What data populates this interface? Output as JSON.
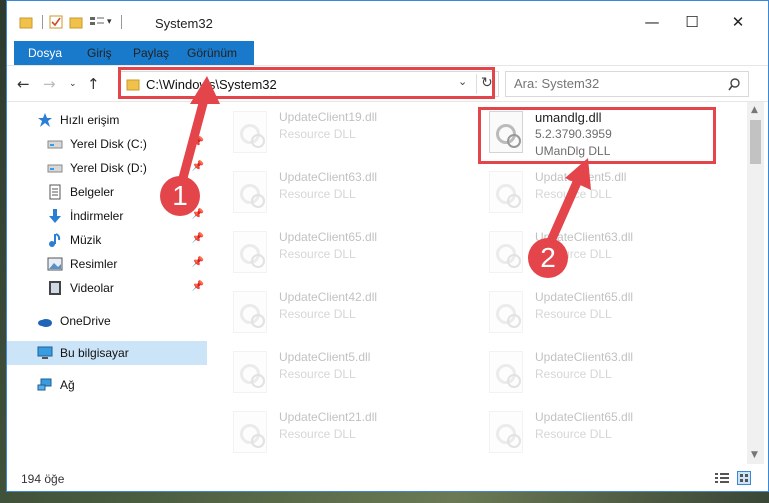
{
  "window": {
    "title": "System32",
    "minimize_icon": "minimize-icon",
    "maximize_icon": "maximize-icon",
    "close_icon": "close-icon"
  },
  "ribbon": {
    "tabs": [
      {
        "label": "Dosya"
      },
      {
        "label": "Giriş"
      },
      {
        "label": "Paylaş"
      },
      {
        "label": "Görünüm"
      }
    ]
  },
  "address": {
    "path": "C:\\Windows\\System32"
  },
  "search": {
    "placeholder": "Ara: System32"
  },
  "sidebar": {
    "items": [
      {
        "label": "Hızlı erişim",
        "icon": "star-icon"
      },
      {
        "label": "Yerel Disk (C:)",
        "icon": "drive-icon"
      },
      {
        "label": "Yerel Disk (D:)",
        "icon": "drive-icon"
      },
      {
        "label": "Belgeler",
        "icon": "documents-icon"
      },
      {
        "label": "İndirmeler",
        "icon": "download-icon"
      },
      {
        "label": "Müzik",
        "icon": "music-icon"
      },
      {
        "label": "Resimler",
        "icon": "pictures-icon"
      },
      {
        "label": "Videolar",
        "icon": "videos-icon"
      },
      {
        "label": "OneDrive",
        "icon": "cloud-icon"
      },
      {
        "label": "Bu bilgisayar",
        "icon": "computer-icon"
      },
      {
        "label": "Ağ",
        "icon": "network-icon"
      }
    ]
  },
  "files": {
    "left": [
      {
        "name": "UpdateClient19.dll",
        "type": "Resource DLL"
      },
      {
        "name": "UpdateClient63.dll",
        "type": "Resource DLL"
      },
      {
        "name": "UpdateClient65.dll",
        "type": "Resource DLL"
      },
      {
        "name": "UpdateClient42.dll",
        "type": "Resource DLL"
      },
      {
        "name": "UpdateClient5.dll",
        "type": "Resource DLL"
      },
      {
        "name": "UpdateClient21.dll",
        "type": "Resource DLL"
      }
    ],
    "highlighted": {
      "name": "umandlg.dll",
      "version": "5.2.3790.3959",
      "description": "UManDlg DLL"
    },
    "right": [
      {
        "name": "UpdateClient5.dll",
        "type": "Resource DLL"
      },
      {
        "name": "UpdateClient63.dll",
        "type": "Resource DLL"
      },
      {
        "name": "UpdateClient65.dll",
        "type": "Resource DLL"
      },
      {
        "name": "UpdateClient63.dll",
        "type": "Resource DLL"
      },
      {
        "name": "UpdateClient65.dll",
        "type": "Resource DLL"
      }
    ]
  },
  "status": {
    "item_count": "194 öğe"
  },
  "annotations": {
    "badge1": "1",
    "badge2": "2",
    "color": "#e3454b"
  }
}
